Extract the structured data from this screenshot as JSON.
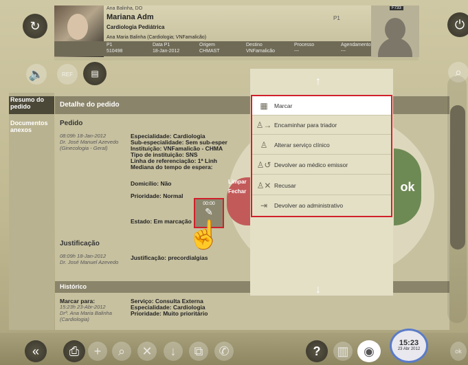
{
  "header": {
    "top_line": "Ana Balinha, DO",
    "user_name": "Mariana Adm",
    "specialty": "Cardiologia Pediátrica",
    "doctor_line": "Ana Maria Balinha (Cardiologia; VNFamalicão)",
    "p1_label": "P1",
    "p1_value": "P1",
    "p1_id": "510498",
    "data_label": "Data P1",
    "data_value": "18-Jan-2012",
    "origem_label": "Origem",
    "origem_value": "CHMAST",
    "destino_label": "Destino",
    "destino_value": "VNFamalicão",
    "processo_label": "Processo",
    "processo_value": "---",
    "agendamento_label": "Agendamento",
    "agendamento_value": "---",
    "code_right": "F733",
    "right_p1": "P1"
  },
  "left_nav": [
    {
      "label": "Resumo do pedido",
      "selected": true
    },
    {
      "label": "Documentos anexos",
      "selected": false
    }
  ],
  "main": {
    "header": "Detalhe do pedido",
    "pedido_title": "Pedido",
    "pedido_time": "08:09h 18-Jan-2012",
    "pedido_doctor": "Dr. José Manuel Azevedo",
    "pedido_dept": "(Ginecologia - Geral)",
    "especialidade": "Especialidade: Cardiologia",
    "subespecialidade": "Sub-especialidade: Sem sub-esper",
    "instituicao": "Instituição: VNFamalicão - CHMA",
    "tipo_instituicao": "Tipo de instituição: SNS",
    "linha_ref": "Linha de referenciação: 1ª Linh",
    "mediana": "Mediana do tempo de espera:",
    "domicilio": "Domicílio: Não",
    "prioridade": "Prioridade: Normal",
    "estado": "Estado: Em marcação",
    "justificacao_title": "Justificação",
    "just_time": "08:09h 18-Jan-2012",
    "just_doctor": "Dr. José Manuel Azevedo",
    "justificacao": "Justificação: precordialgias",
    "historico_title": "Histórico",
    "marcar_para": "Marcar para:",
    "hist_time": "15:23h 23-Abr-2012",
    "hist_doctor": "Drª. Ana Maria Balinha",
    "hist_dept": "(Cardiologia)",
    "servico": "Serviço: Consulta Externa",
    "hist_especialidade": "Especialidade: Cardiologia",
    "hist_prioridade": "Prioridade: Muito prioritário",
    "timer": "00:00"
  },
  "menu": {
    "items": [
      {
        "label": "Marcar",
        "icon": "calendar-icon"
      },
      {
        "label": "Encaminhar para triador",
        "icon": "forward-user-icon"
      },
      {
        "label": "Alterar serviço clínico",
        "icon": "user-icon"
      },
      {
        "label": "Devolver ao médico emissor",
        "icon": "return-user-icon"
      },
      {
        "label": "Recusar",
        "icon": "reject-user-icon"
      },
      {
        "label": "Devolver ao administrativo",
        "icon": "return-admin-icon"
      }
    ],
    "ok_label": "ok",
    "limpar_label": "Limpar",
    "fechar_label": "Fechar"
  },
  "clock": {
    "time": "15:23",
    "date": "23 Abr 2012"
  },
  "bottom": {
    "ok_label": "ok"
  },
  "colors": {
    "accent_red": "#d0202a",
    "ok_green": "#6e8a54",
    "panel": "#c7c1a0"
  }
}
